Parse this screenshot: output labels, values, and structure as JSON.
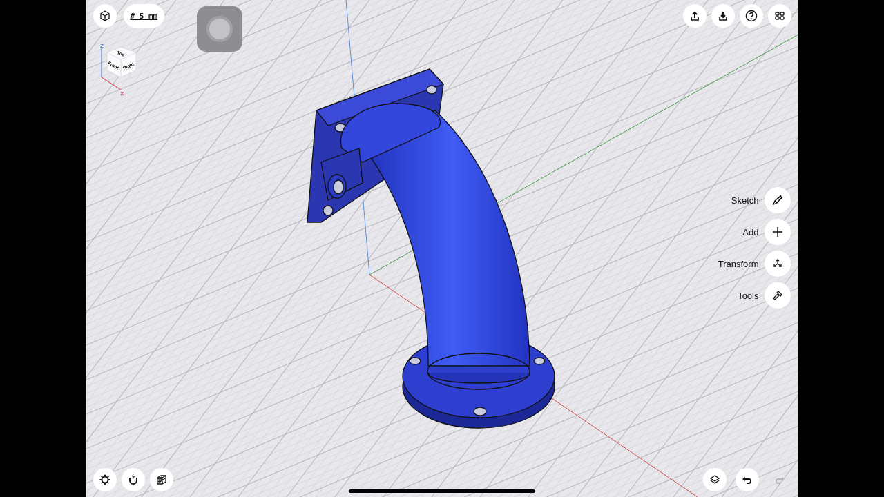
{
  "top_left": {
    "grid_size": "# 5 mm"
  },
  "view_cube": {
    "faces": [
      "Top",
      "Front",
      "Right"
    ],
    "axes": [
      "Z",
      "X"
    ]
  },
  "top_right": [
    {
      "kind": "export"
    },
    {
      "kind": "import"
    },
    {
      "kind": "help"
    },
    {
      "kind": "apps"
    }
  ],
  "tool_menu": [
    {
      "label": "Sketch",
      "kind": "sketch"
    },
    {
      "label": "Add",
      "kind": "add"
    },
    {
      "label": "Transform",
      "kind": "transform"
    },
    {
      "label": "Tools",
      "kind": "tools"
    }
  ],
  "bottom_left": [
    {
      "kind": "settings"
    },
    {
      "kind": "snap"
    },
    {
      "kind": "section"
    }
  ],
  "history": [
    {
      "kind": "layers",
      "disabled": false
    },
    {
      "kind": "undo",
      "disabled": false
    },
    {
      "kind": "redo",
      "disabled": true
    }
  ]
}
